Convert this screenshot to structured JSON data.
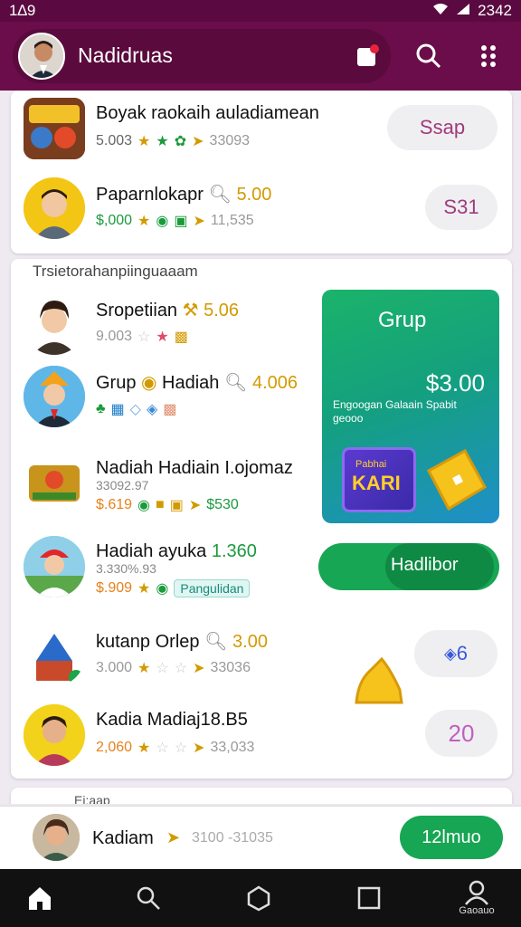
{
  "status": {
    "time": "1∆9",
    "right_time": "2342"
  },
  "header": {
    "title": "Nadidruas"
  },
  "top_card": {
    "items": [
      {
        "name": "Boyak raokaih auladiamean",
        "meta_value": "5.003",
        "meta_count": "33093",
        "button": "Ssap"
      },
      {
        "name": "Paparnlokapr",
        "badge": "5.00",
        "meta_value": "$,000",
        "meta_count": "11,535",
        "button": "S31"
      }
    ]
  },
  "main_card": {
    "section_title": "Trsietorahanpiinguaaam",
    "items": [
      {
        "name": "Sropetiian",
        "badge": "5.06",
        "meta_value": "9.003"
      },
      {
        "name": "Grup",
        "name2": "Hadiah",
        "badge": "4.006",
        "meta_value": ""
      },
      {
        "name": "Nadiah Hadiain I.ojomaz",
        "sub": "33092.97",
        "meta_value": "$.619",
        "meta_badge": "$530"
      },
      {
        "name": "Hadiah ayuka",
        "badge": "1.360",
        "sub": "3.330%.93",
        "meta_value": "$.909",
        "chip": "Pangulidan",
        "button": "Hadlibor"
      },
      {
        "name": "kutanp Orlep",
        "badge": "3.00",
        "meta_value": "3.000",
        "meta_count": "33036",
        "button": "6"
      },
      {
        "name": "Kadia Madiaj",
        "badge": "18.B5",
        "meta_value": "2,060",
        "meta_count": "33,033",
        "button": "20"
      }
    ],
    "promo": {
      "title": "Grup",
      "amount": "$3.00",
      "desc": "Engoogan Galaain Spabit geooo",
      "kari_top": "Pabhai",
      "kari": "KARI"
    }
  },
  "bottom_bar": {
    "peek_label": "Ei:aap",
    "name": "Kadiam",
    "meta": "3100 -31035",
    "button": "12lmuo"
  },
  "nav": {
    "account_label": "Gaoauo"
  },
  "colors": {
    "brand": "#6a0d4a",
    "accent_green": "#17a653",
    "purple_text": "#a03a7c"
  }
}
